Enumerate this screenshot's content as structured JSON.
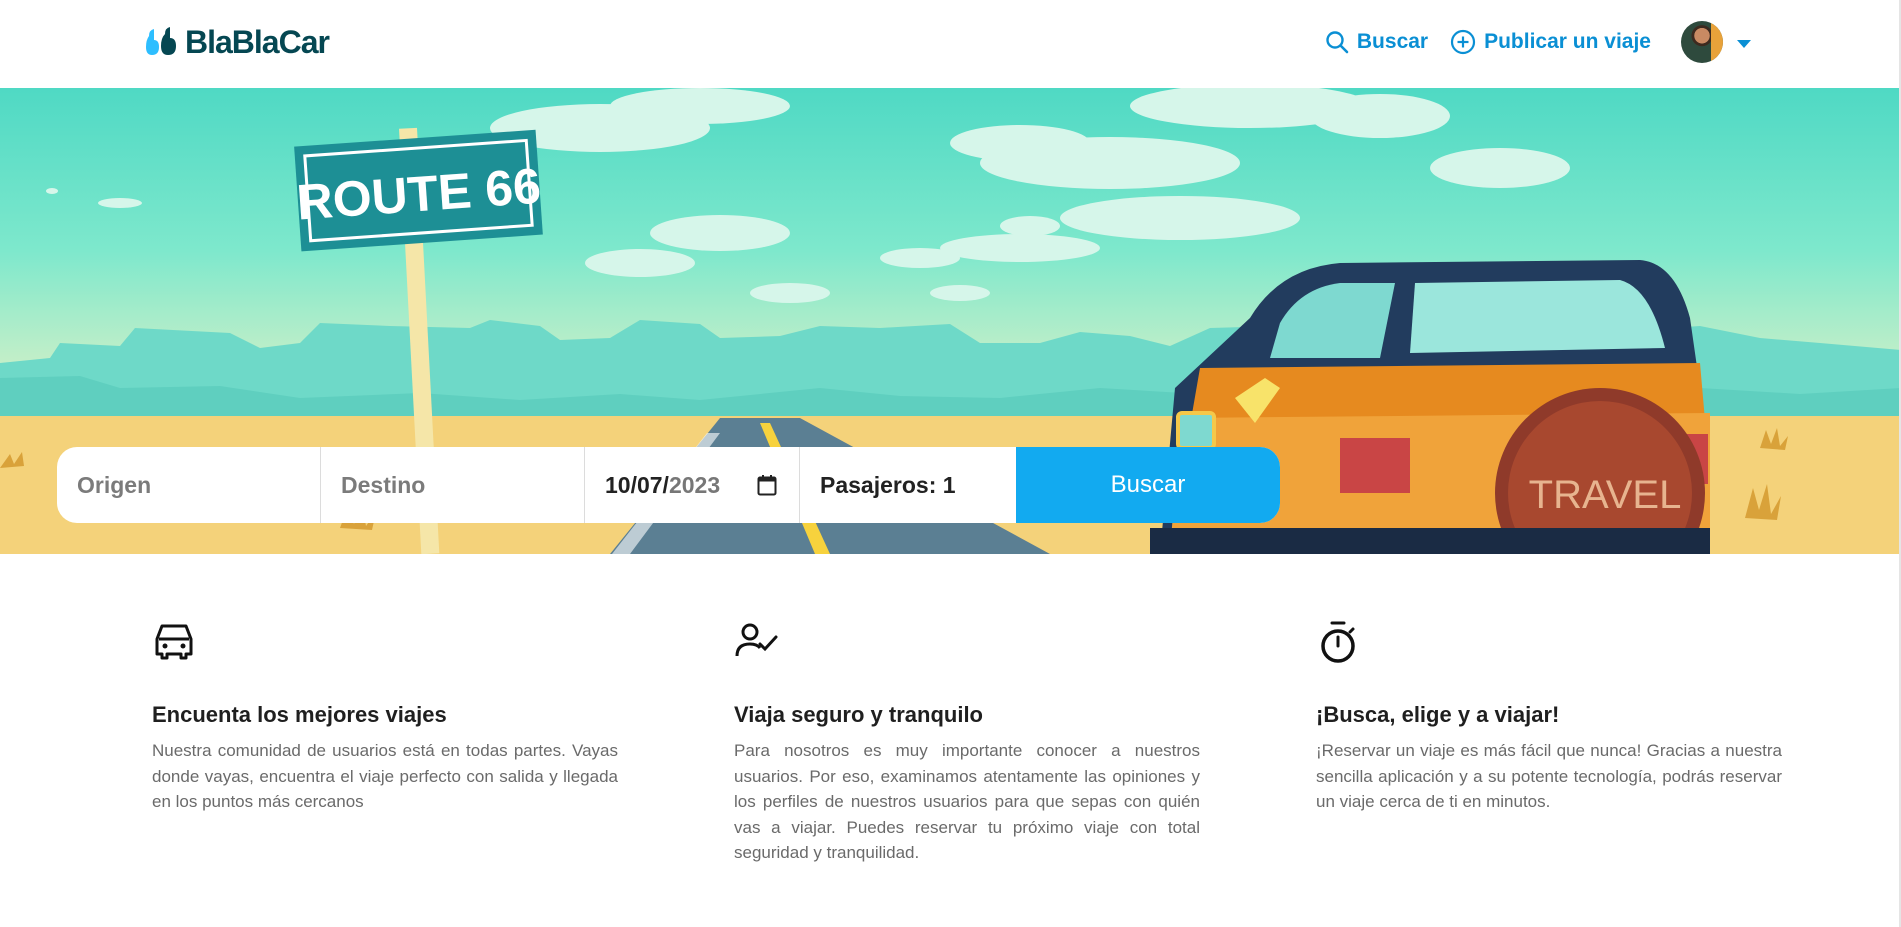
{
  "header": {
    "brand": "BlaBlaCar",
    "nav": {
      "search_label": "Buscar",
      "search_icon": "search-icon",
      "publish_label": "Publicar un viaje",
      "publish_icon": "plus-circle-icon"
    },
    "colors": {
      "brand": "#054752",
      "accent": "#0a8fd4"
    }
  },
  "hero": {
    "sign_text": "ROUTE 66",
    "tire_text": "TRAVEL"
  },
  "search": {
    "origin_placeholder": "Origen",
    "destination_placeholder": "Destino",
    "date_value_main": "10/07/",
    "date_value_year": "2023",
    "passengers_label": "Pasajeros: 1",
    "button_label": "Buscar",
    "button_color": "#12aaf0"
  },
  "features": [
    {
      "icon": "car-icon",
      "title": "Encuenta los mejores viajes",
      "text": "Nuestra comunidad de usuarios está en todas partes. Vayas donde vayas, encuentra el viaje perfecto con salida y llegada en los puntos más cercanos"
    },
    {
      "icon": "user-check-icon",
      "title": "Viaja seguro y tranquilo",
      "text": "Para nosotros es muy importante conocer a nuestros usuarios. Por eso, examinamos atentamente las opiniones y los perfiles de nuestros usuarios para que sepas con quién vas a viajar. Puedes reservar tu próximo viaje con total seguridad y tranquilidad."
    },
    {
      "icon": "stopwatch-icon",
      "title": "¡Busca, elige y a viajar!",
      "text": "¡Reservar un viaje es más fácil que nunca! Gracias a nuestra sencilla aplicación y a su potente tecnología, podrás reservar un viaje cerca de ti en minutos."
    }
  ]
}
